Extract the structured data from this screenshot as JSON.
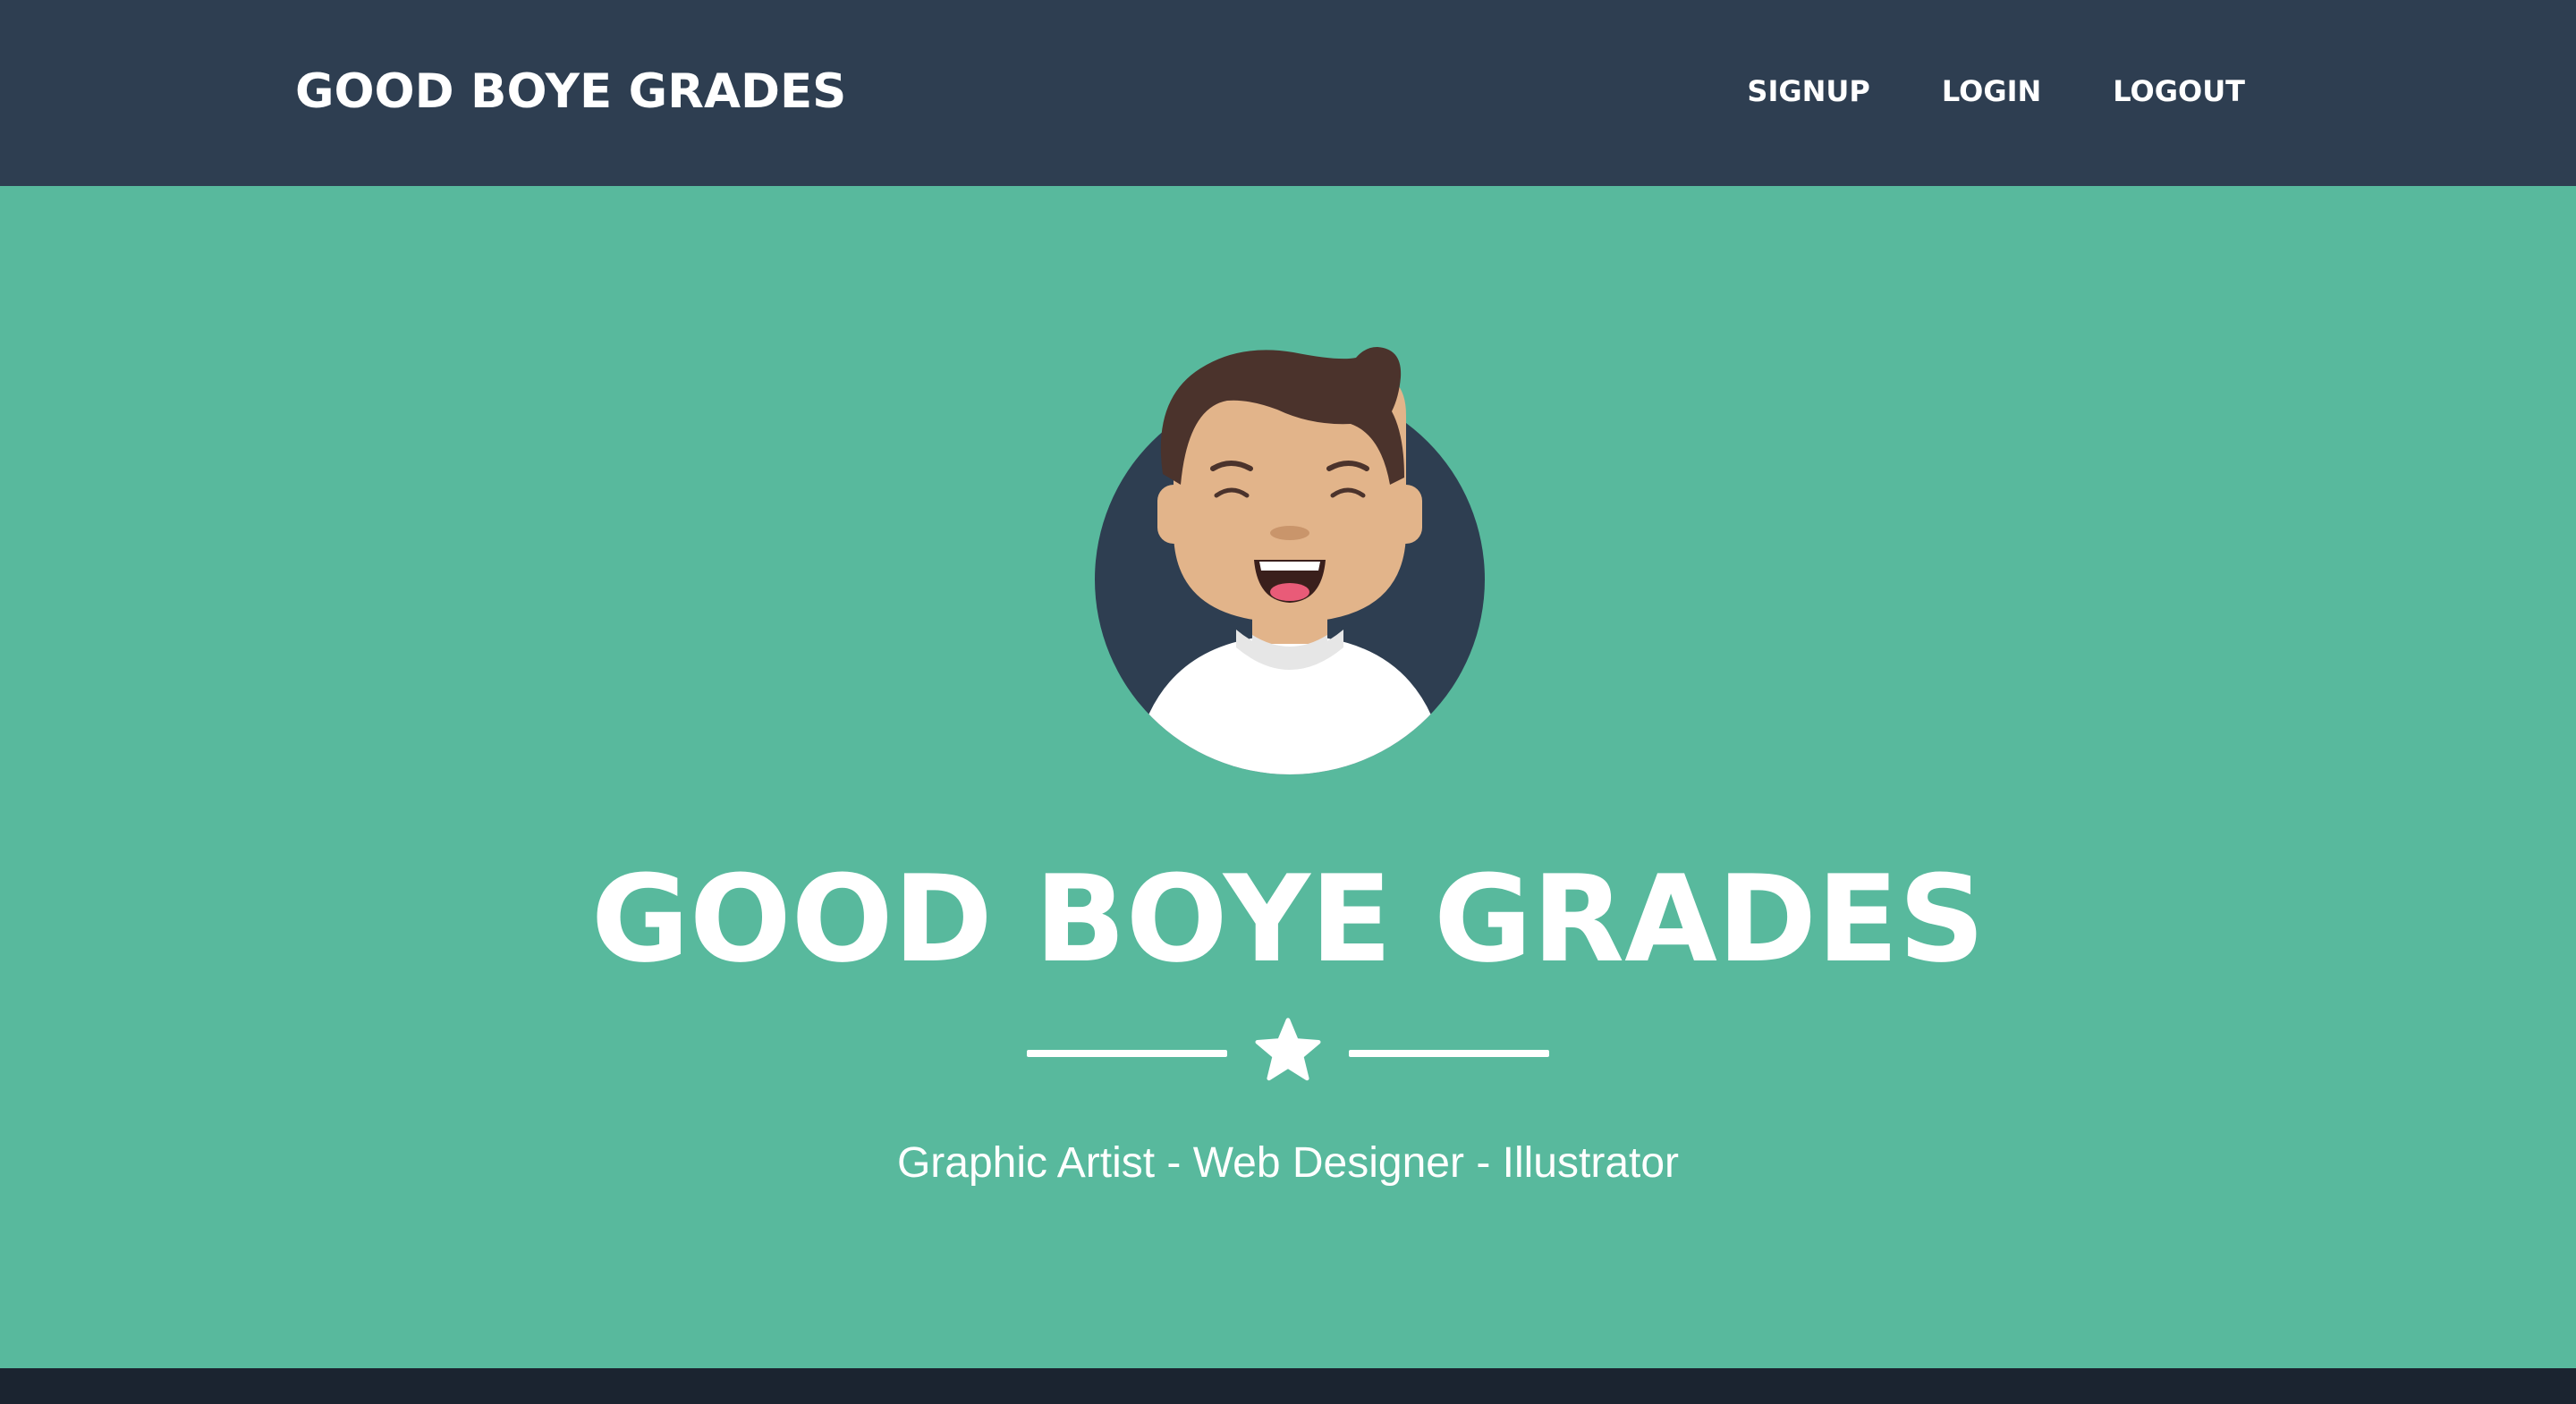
{
  "navbar": {
    "brand": "GOOD BOYE GRADES",
    "links": [
      {
        "label": "SIGNUP"
      },
      {
        "label": "LOGIN"
      },
      {
        "label": "LOGOUT"
      }
    ]
  },
  "hero": {
    "avatar_icon": "avatar-icon",
    "title": "GOOD BOYE GRADES",
    "divider_icon": "star-icon",
    "subtitle": "Graphic Artist - Web Designer - Illustrator"
  },
  "colors": {
    "navbar_bg": "#2e3e51",
    "hero_bg": "#58b99d",
    "footer_bg": "#1b2430",
    "text": "#ffffff"
  }
}
